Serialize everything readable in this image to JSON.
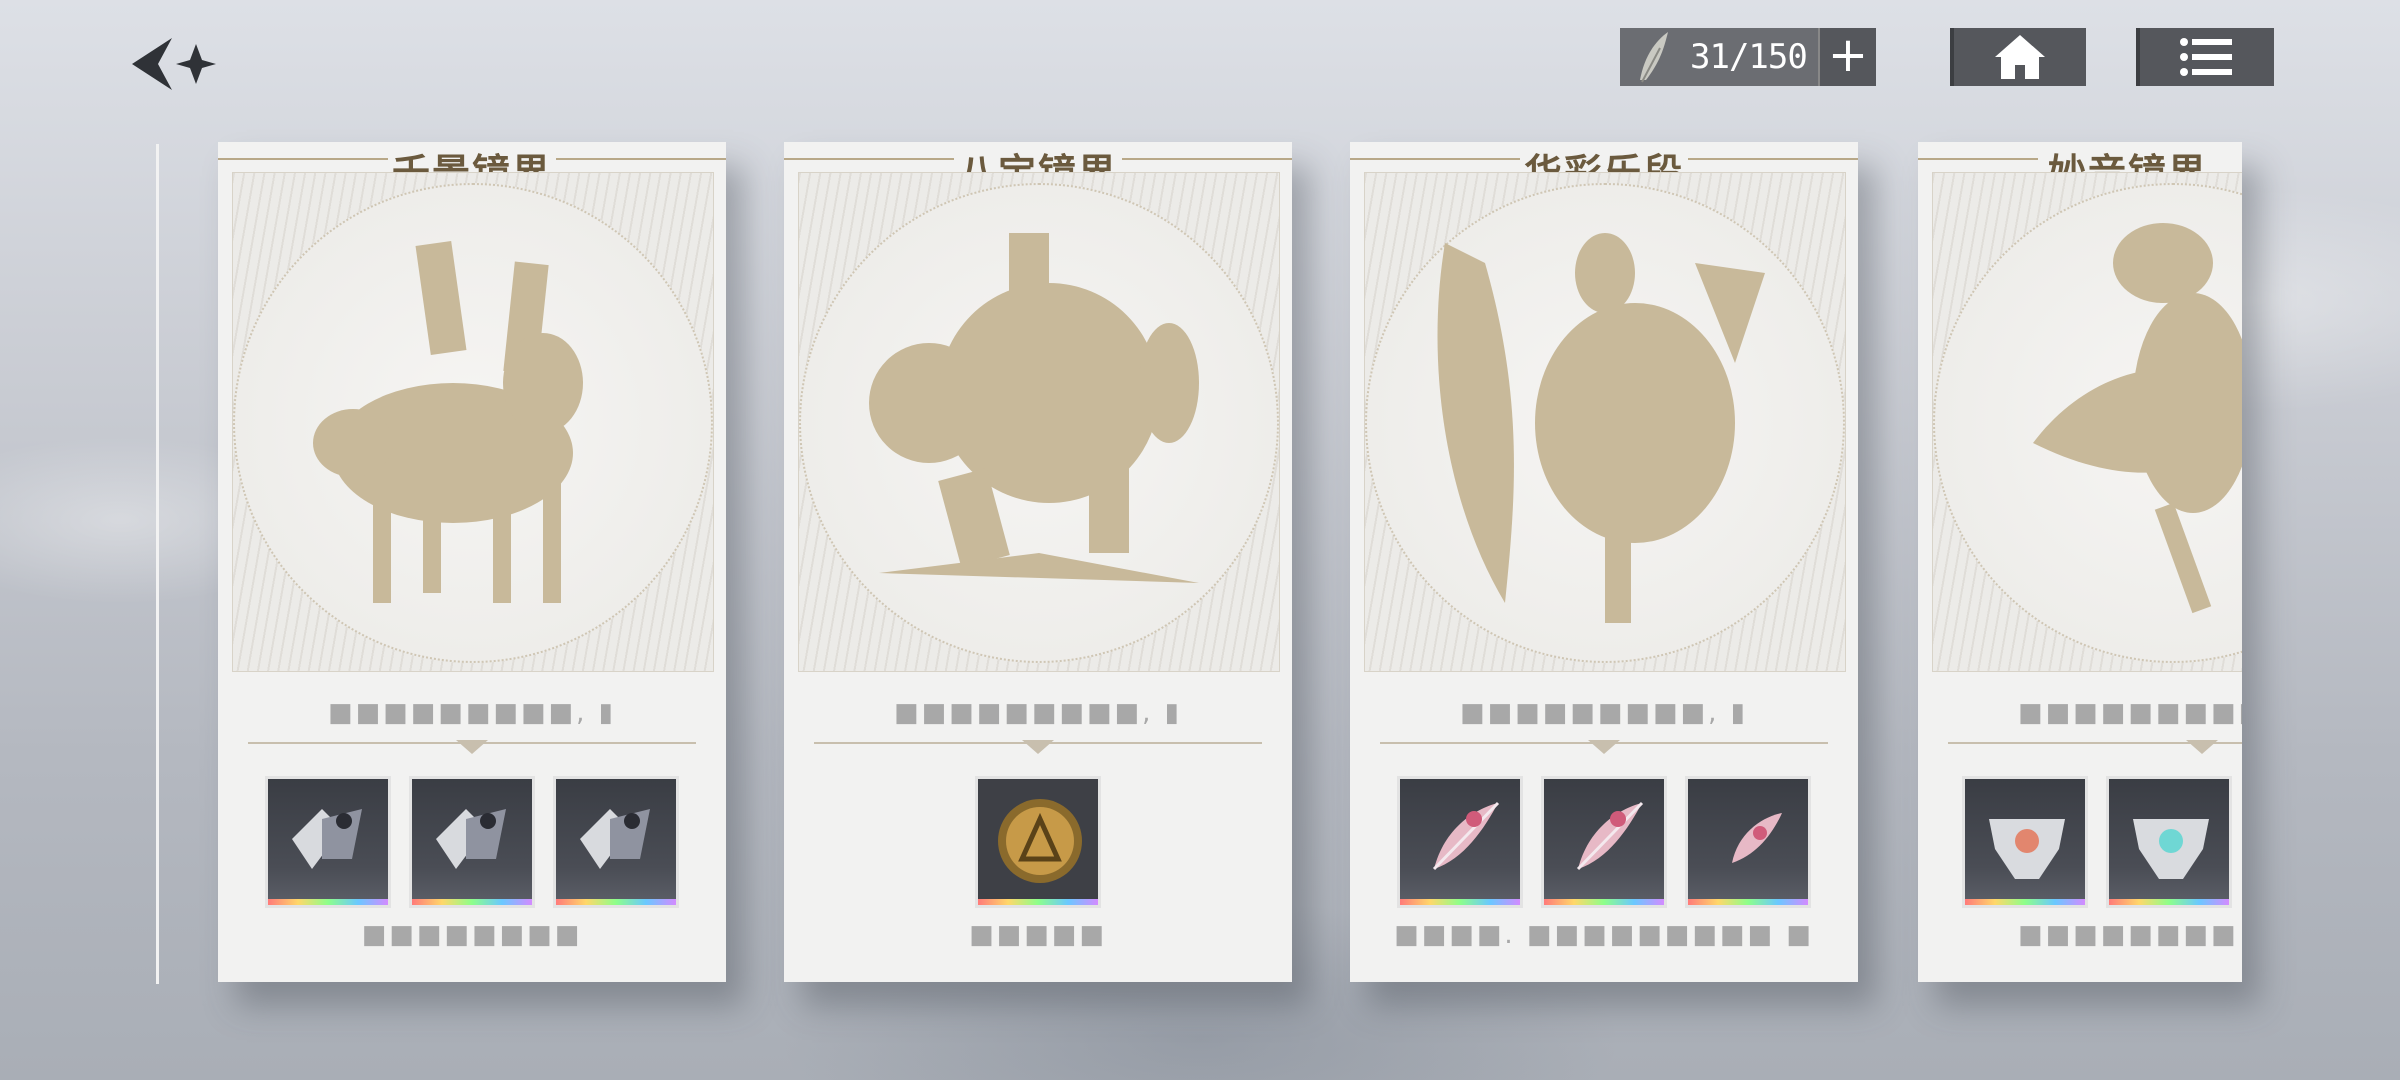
{
  "stamina": {
    "value": "31/150",
    "plus_label": "+"
  },
  "cards": [
    {
      "title": "千景镜界",
      "progress": "■■■■■■■■■, ▮",
      "rewards": [
        "shard-item-icon",
        "shard-item-icon",
        "shard-item-icon"
      ],
      "caption": "■■■■■■■■"
    },
    {
      "title": "八宝镜界",
      "progress": "■■■■■■■■■, ▮",
      "rewards": [
        "gold-coin-icon"
      ],
      "caption": "■■■■■"
    },
    {
      "title": "华彩乐段",
      "progress": "■■■■■■■■■, ▮",
      "rewards": [
        "pink-feather-icon",
        "pink-feather-icon",
        "pink-feather-icon"
      ],
      "caption": "■■■■. ■■■■■■■■■ ■"
    },
    {
      "title": "妙音镜界",
      "progress": "■■■■■■■■■",
      "rewards": [
        "crystal-mask-icon",
        "crystal-mask-icon"
      ],
      "caption": "■■■■■■■■"
    }
  ]
}
